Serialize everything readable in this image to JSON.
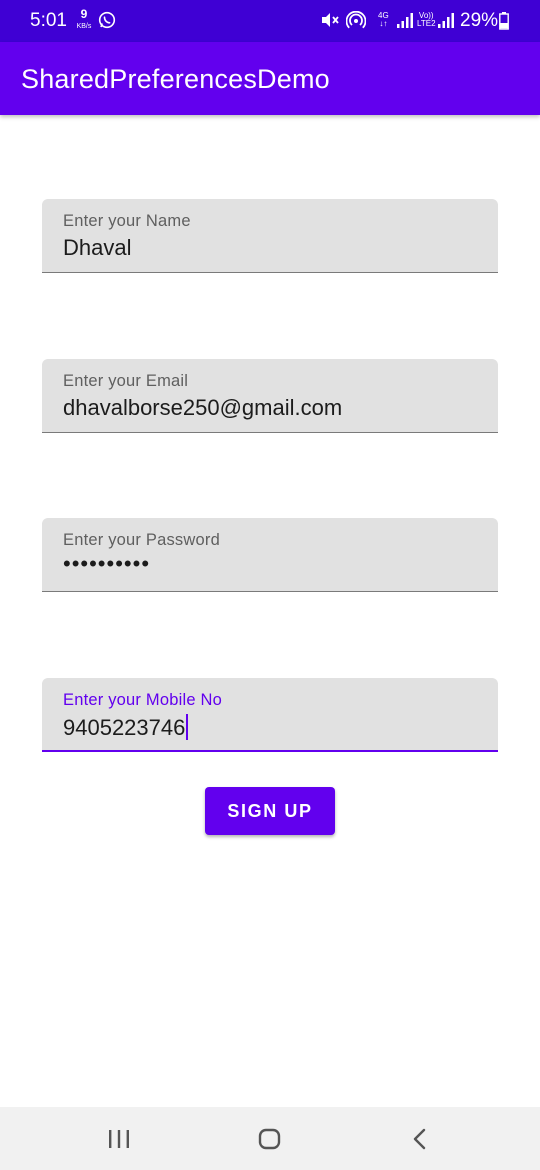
{
  "status_bar": {
    "time": "5:01",
    "net_speed_value": "9",
    "net_speed_unit": "KB/s",
    "network_type": "4G",
    "volte_label_top": "Vo))",
    "volte_label_bottom": "LTE2",
    "battery": "29%",
    "icons": [
      "whatsapp-icon",
      "mute-icon",
      "hotspot-icon",
      "signal-icon",
      "battery-icon"
    ]
  },
  "app_bar": {
    "title": "SharedPreferencesDemo",
    "color": "#6200ee"
  },
  "form": {
    "name": {
      "label": "Enter your Name",
      "value": "Dhaval"
    },
    "email": {
      "label": "Enter your Email",
      "value": "dhavalborse250@gmail.com"
    },
    "password": {
      "label": "Enter your Password",
      "value": "••••••••••"
    },
    "mobile": {
      "label": "Enter your Mobile No",
      "value": "9405223746",
      "focused": true
    }
  },
  "signup_button": {
    "label": "SIGN UP"
  },
  "nav_bar": {
    "icons": [
      "recents-icon",
      "home-icon",
      "back-icon"
    ]
  }
}
